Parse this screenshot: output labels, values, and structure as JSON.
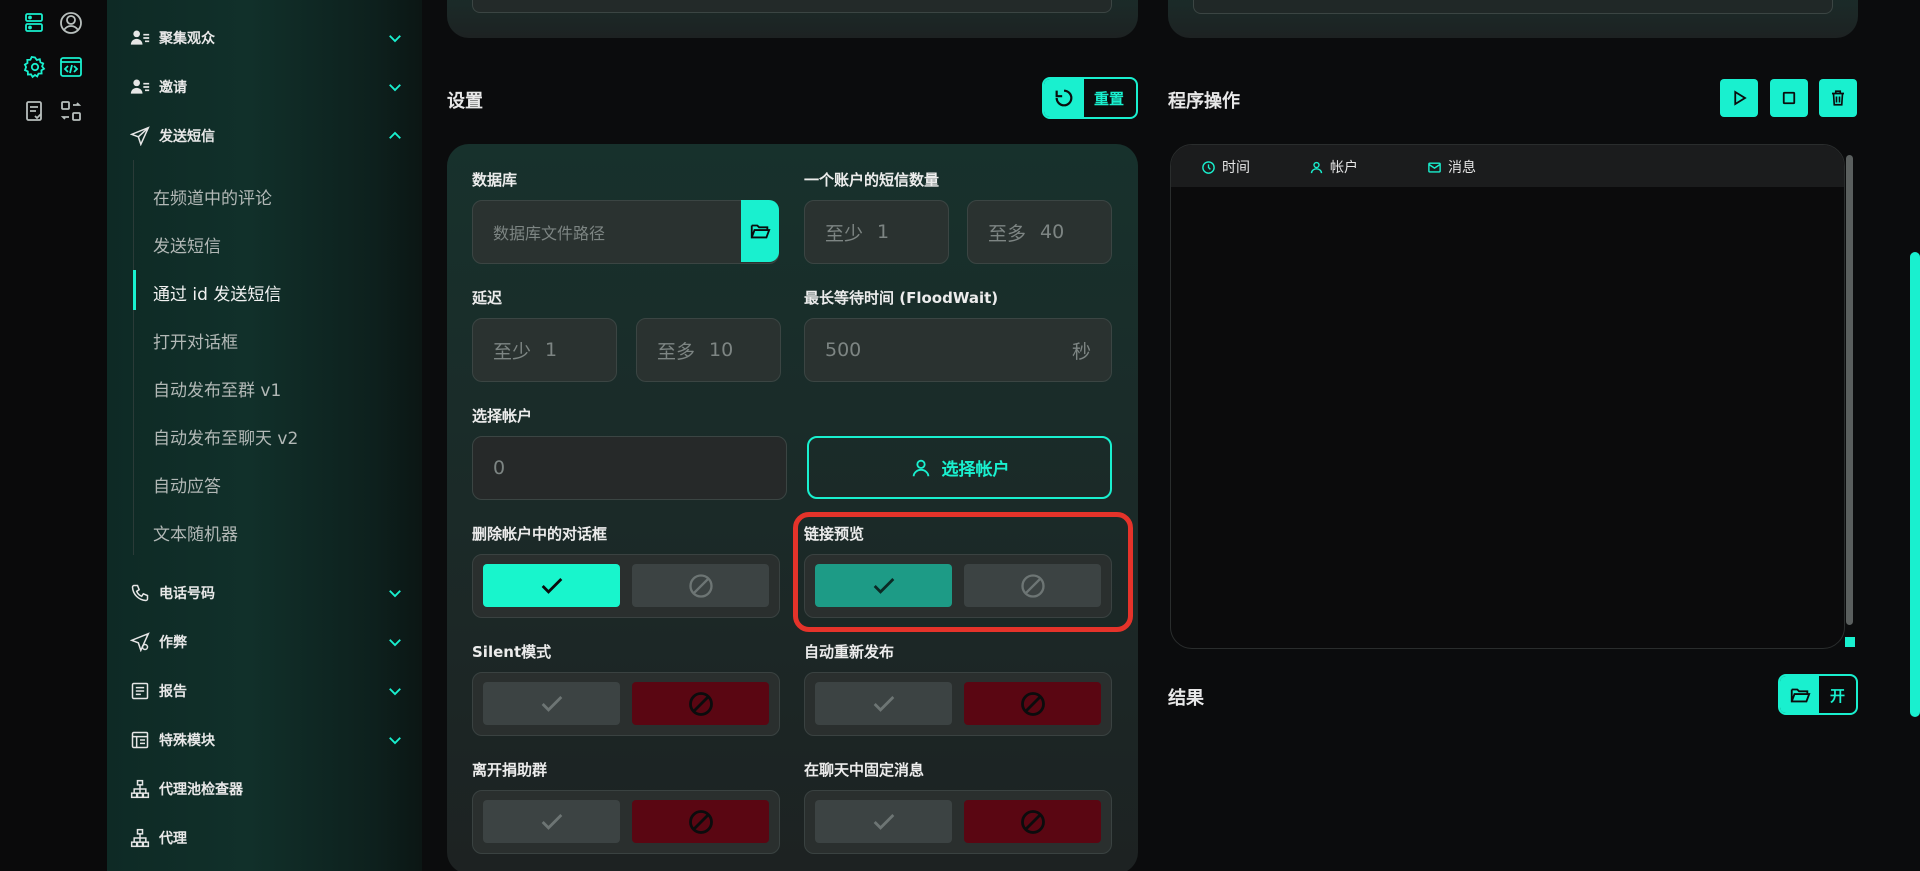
{
  "sidebar": {
    "items": [
      {
        "label": "聚集观众",
        "icon": "users-icon",
        "expanded": false
      },
      {
        "label": "邀请",
        "icon": "users-icon",
        "expanded": false
      },
      {
        "label": "发送短信",
        "icon": "send-icon",
        "expanded": true
      },
      {
        "label": "电话号码",
        "icon": "phone-icon",
        "expanded": false
      },
      {
        "label": "作弊",
        "icon": "send-gear-icon",
        "expanded": false
      },
      {
        "label": "报告",
        "icon": "report-icon",
        "expanded": false
      },
      {
        "label": "特殊模块",
        "icon": "module-icon",
        "expanded": false
      },
      {
        "label": "代理池检查器",
        "icon": "network-icon"
      },
      {
        "label": "代理",
        "icon": "network-icon"
      }
    ],
    "subitems": [
      "在频道中的评论",
      "发送短信",
      "通过 id 发送短信",
      "打开对话框",
      "自动发布至群 v1",
      "自动发布至聊天 v2",
      "自动应答",
      "文本随机器"
    ],
    "active_subitem": 2
  },
  "settings": {
    "title": "设置",
    "reset_label": "重置",
    "database_label": "数据库",
    "database_placeholder": "数据库文件路径",
    "sms_count_label": "一个账户的短信数量",
    "sms_min_prefix": "至少",
    "sms_min": "1",
    "sms_max_prefix": "至多",
    "sms_max": "40",
    "delay_label": "延迟",
    "delay_min_prefix": "至少",
    "delay_min": "1",
    "delay_max_prefix": "至多",
    "delay_max": "10",
    "floodwait_label": "最长等待时间 (FloodWait)",
    "floodwait_value": "500",
    "floodwait_unit": "秒",
    "select_account_label": "选择帐户",
    "select_account_value": "0",
    "select_account_button": "选择帐户",
    "delete_dialogs_label": "删除帐户中的对话框",
    "delete_dialogs_on": true,
    "link_preview_label": "链接预览",
    "link_preview_on": true,
    "silent_label": "Silent模式",
    "silent_on": false,
    "auto_repost_label": "自动重新发布",
    "auto_repost_on": false,
    "leave_group_label": "离开捐助群",
    "leave_group_on": false,
    "pin_message_label": "在聊天中固定消息",
    "pin_message_on": false
  },
  "program": {
    "title": "程序操作",
    "columns": [
      "时间",
      "帐户",
      "消息"
    ]
  },
  "result": {
    "title": "结果",
    "open_label": "开"
  },
  "colors": {
    "accent": "#19f0cf",
    "danger": "#5a0612",
    "highlight": "#e5332a"
  }
}
